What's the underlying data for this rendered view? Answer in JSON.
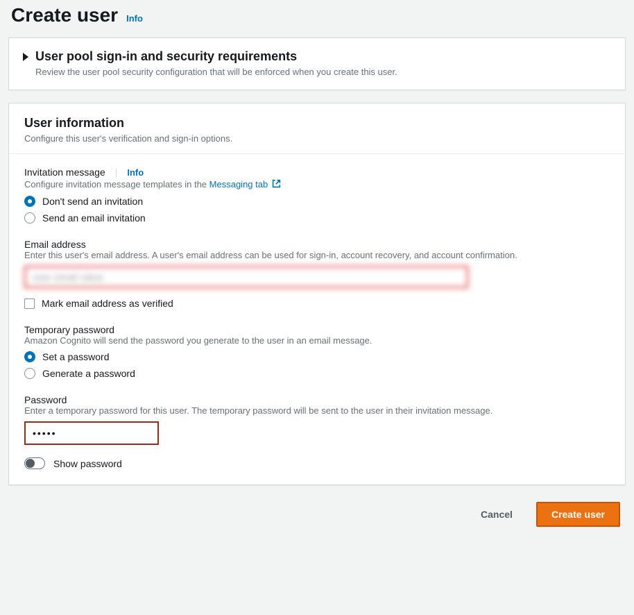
{
  "header": {
    "title": "Create user",
    "info": "Info"
  },
  "requirements_panel": {
    "title": "User pool sign-in and security requirements",
    "desc": "Review the user pool security configuration that will be enforced when you create this user."
  },
  "userinfo_panel": {
    "title": "User information",
    "desc": "Configure this user's verification and sign-in options."
  },
  "invitation": {
    "label": "Invitation message",
    "info": "Info",
    "desc_prefix": "Configure invitation message templates in the ",
    "desc_link": "Messaging tab",
    "radios": {
      "dont_send": "Don't send an invitation",
      "send_email": "Send an email invitation"
    }
  },
  "email": {
    "label": "Email address",
    "desc": "Enter this user's email address. A user's email address can be used for sign-in, account recovery, and account confirmation.",
    "value": "user email value",
    "verified_label": "Mark email address as verified"
  },
  "temp_pwd": {
    "label": "Temporary password",
    "desc": "Amazon Cognito will send the password you generate to the user in an email message.",
    "radios": {
      "set": "Set a password",
      "generate": "Generate a password"
    }
  },
  "password": {
    "label": "Password",
    "desc": "Enter a temporary password for this user. The temporary password will be sent to the user in their invitation message.",
    "value": "•••••",
    "show_label": "Show password"
  },
  "footer": {
    "cancel": "Cancel",
    "create": "Create user"
  }
}
